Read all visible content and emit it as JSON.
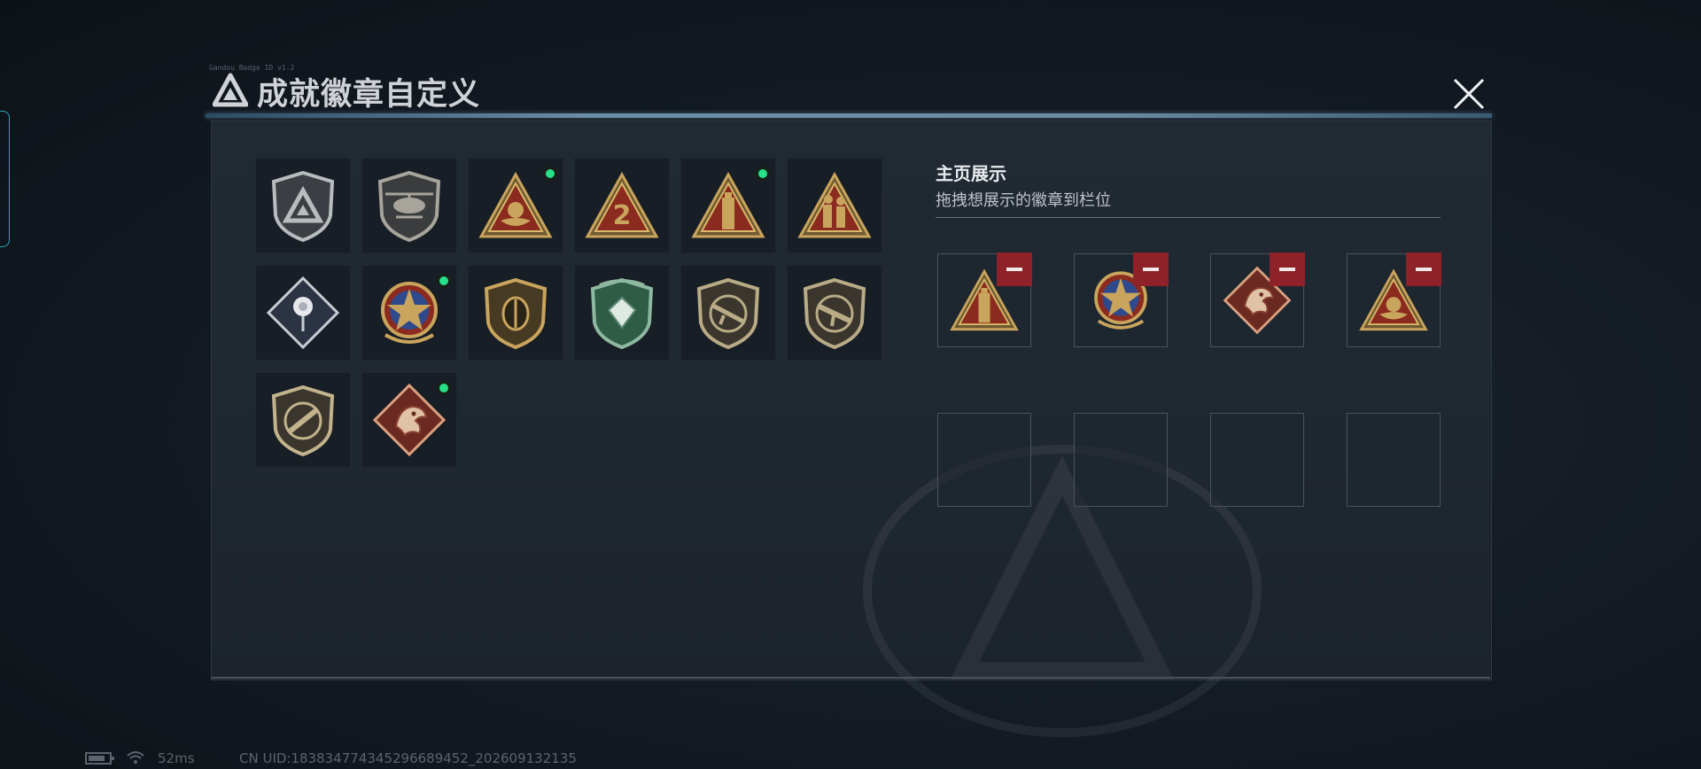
{
  "header": {
    "title": "成就徽章自定义",
    "tiny_text": "Gandou Badge ID v1.2"
  },
  "badges": [
    {
      "icon": "silver-triangle-shield-icon",
      "new": false
    },
    {
      "icon": "helicopter-shield-icon",
      "new": false
    },
    {
      "icon": "gold-triangle-nest-icon",
      "new": true
    },
    {
      "icon": "gold-triangle-number-2-icon",
      "new": false
    },
    {
      "icon": "gold-triangle-tower-icon",
      "new": true
    },
    {
      "icon": "gold-triangle-soldiers-icon",
      "new": false
    },
    {
      "icon": "silver-diamond-rose-icon",
      "new": false
    },
    {
      "icon": "star-medal-icon",
      "new": true
    },
    {
      "icon": "gold-crest-shield-icon",
      "new": false
    },
    {
      "icon": "green-diamond-shield-icon",
      "new": false
    },
    {
      "icon": "rifle-shield-icon",
      "new": false
    },
    {
      "icon": "smg-shield-icon",
      "new": false
    },
    {
      "icon": "knife-shield-icon",
      "new": false
    },
    {
      "icon": "dragon-diamond-icon",
      "new": true
    }
  ],
  "display": {
    "title": "主页展示",
    "subtitle": "拖拽想展示的徽章到栏位",
    "slots": [
      {
        "icon": "gold-triangle-tower-icon"
      },
      {
        "icon": "star-medal-icon"
      },
      {
        "icon": "dragon-diamond-icon"
      },
      {
        "icon": "gold-triangle-nest-icon"
      },
      {
        "icon": ""
      },
      {
        "icon": ""
      },
      {
        "icon": ""
      },
      {
        "icon": ""
      }
    ]
  },
  "status": {
    "ping": "52ms",
    "uid": "CN UID:18383477434529668945​2_202609132135"
  },
  "colors": {
    "accent_line": "#6b8ea8",
    "new_dot": "#26e08a",
    "remove_button": "#8f2229",
    "gold": "#c9a45c",
    "badge_red": "#8b2a1e"
  }
}
